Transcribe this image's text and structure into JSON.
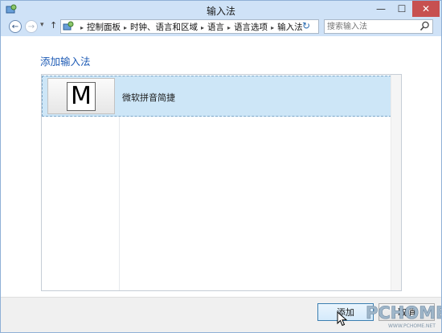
{
  "window": {
    "title": "输入法",
    "min_glyph": "—",
    "max_glyph": "☐",
    "close_glyph": "✕"
  },
  "nav": {
    "back_glyph": "←",
    "forward_glyph": "→",
    "history_glyph": "▾",
    "up_glyph": "↑",
    "breadcrumbs": [
      "控制面板",
      "时钟、语言和区域",
      "语言",
      "语言选项",
      "输入法"
    ],
    "crumb_sep": "▸",
    "dropdown_glyph": "⌄",
    "refresh_glyph": "↻",
    "search_placeholder": "搜索输入法"
  },
  "main": {
    "heading": "添加输入法",
    "items": [
      {
        "icon_letter": "M",
        "label": "微软拼音简捷"
      }
    ]
  },
  "footer": {
    "add_label": "添加",
    "cancel_label": "取消"
  },
  "watermark": {
    "brand": "PCHOME",
    "url": "WWW.PCHOME.NET"
  },
  "colors": {
    "accent": "#1e5bb5",
    "selection": "#cde6f7",
    "titlebar": "#cfe2f7",
    "close": "#c75050"
  }
}
